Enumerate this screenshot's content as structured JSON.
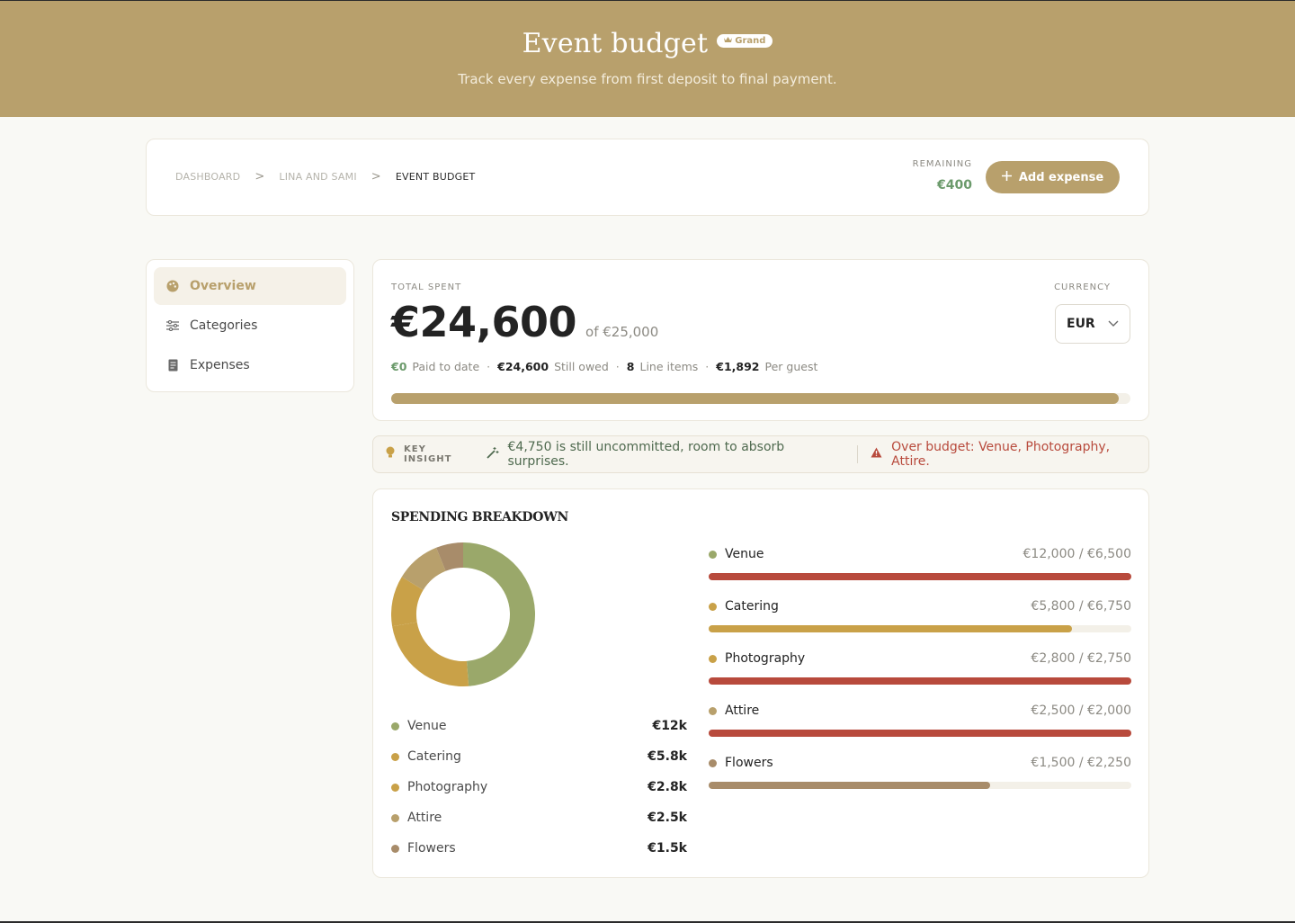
{
  "header": {
    "title": "Event budget",
    "badge": "Grand",
    "subtitle": "Track every expense from first deposit to final payment."
  },
  "breadcrumb": {
    "items": [
      "DASHBOARD",
      "LINA AND SAMI",
      "EVENT BUDGET"
    ]
  },
  "remaining": {
    "label": "REMAINING",
    "value": "€400"
  },
  "add_button": {
    "label": "Add expense"
  },
  "sidebar": {
    "items": [
      {
        "label": "Overview",
        "icon": "palette-icon",
        "active": true
      },
      {
        "label": "Categories",
        "icon": "sliders-icon",
        "active": false
      },
      {
        "label": "Expenses",
        "icon": "receipt-icon",
        "active": false
      }
    ]
  },
  "total": {
    "label": "TOTAL SPENT",
    "amount": "€24,600",
    "of": "of €25,000",
    "progress": 0.984,
    "stats": {
      "paid_value": "€0",
      "paid_label": "Paid to date",
      "owed_value": "€24,600",
      "owed_label": "Still owed",
      "items_value": "8",
      "items_label": "Line items",
      "guest_value": "€1,892",
      "guest_label": "Per guest"
    }
  },
  "currency": {
    "label": "CURRENCY",
    "value": "EUR"
  },
  "insight": {
    "label": "KEY INSIGHT",
    "text": "€4,750 is still uncommitted, room to absorb surprises.",
    "warning": "Over budget: Venue, Photography, Attire."
  },
  "breakdown": {
    "title": "SPENDING BREAKDOWN",
    "legend": [
      {
        "name": "Venue",
        "value": "€12k"
      },
      {
        "name": "Catering",
        "value": "€5.8k"
      },
      {
        "name": "Photography",
        "value": "€2.8k"
      },
      {
        "name": "Attire",
        "value": "€2.5k"
      },
      {
        "name": "Flowers",
        "value": "€1.5k"
      }
    ],
    "categories": [
      {
        "name": "Venue",
        "amounts": "€12,000 / €6,500"
      },
      {
        "name": "Catering",
        "amounts": "€5,800 / €6,750"
      },
      {
        "name": "Photography",
        "amounts": "€2,800 / €2,750"
      },
      {
        "name": "Attire",
        "amounts": "€2,500 / €2,000"
      },
      {
        "name": "Flowers",
        "amounts": "€1,500 / €2,250"
      }
    ]
  },
  "chart_data": {
    "type": "pie",
    "categories": [
      "Venue",
      "Catering",
      "Photography",
      "Attire",
      "Flowers"
    ],
    "values": [
      12000,
      5800,
      2800,
      2500,
      1500
    ],
    "budgets": [
      6500,
      6750,
      2750,
      2000,
      2250
    ],
    "colors": [
      "#9aa86a",
      "#c9a148",
      "#c9a148",
      "#b8a06c",
      "#a88c6a"
    ],
    "bar_colors": [
      "#b84a3c",
      "#c9a148",
      "#b84a3c",
      "#b84a3c",
      "#a88c6a"
    ]
  }
}
